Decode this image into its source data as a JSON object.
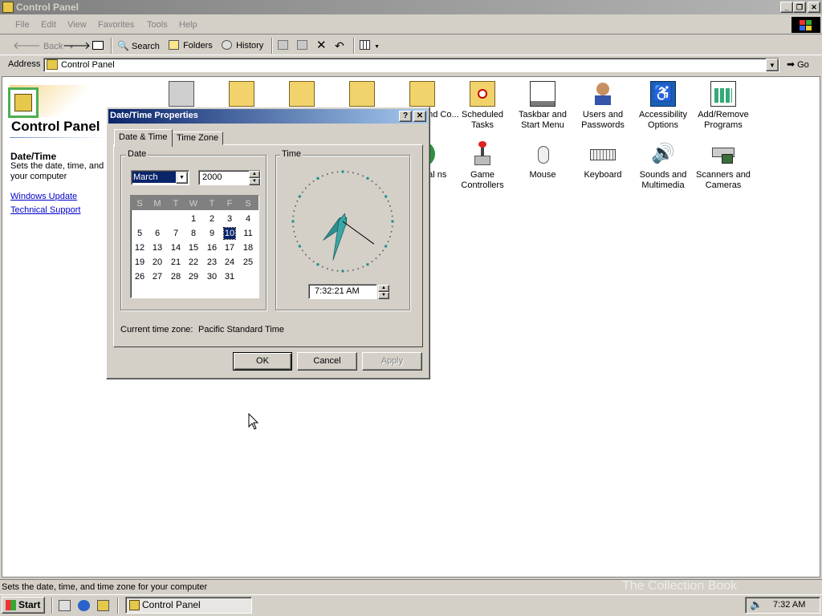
{
  "window": {
    "title": "Control Panel"
  },
  "menu": [
    "File",
    "Edit",
    "View",
    "Favorites",
    "Tools",
    "Help"
  ],
  "toolbar": {
    "back": "Back",
    "search": "Search",
    "folders": "Folders",
    "history": "History"
  },
  "address": {
    "label": "Address",
    "value": "Control Panel",
    "go": "Go"
  },
  "left_panel": {
    "heading": "Control Panel",
    "item_title": "Date/Time",
    "item_desc": "Sets the date, time, and your computer",
    "links": [
      "Windows Update",
      "Technical Support"
    ]
  },
  "icons_row1": [
    {
      "label": "and Co..."
    },
    {
      "label": "Scheduled Tasks"
    },
    {
      "label": "Taskbar and Start Menu"
    },
    {
      "label": "Users and Passwords"
    },
    {
      "label": "Accessibility Options"
    },
    {
      "label": "Add/Remove Programs"
    }
  ],
  "icons_row2": [
    {
      "label": "nal ns"
    },
    {
      "label": "Game Controllers"
    },
    {
      "label": "Mouse"
    },
    {
      "label": "Keyboard"
    },
    {
      "label": "Sounds and Multimedia"
    },
    {
      "label": "Scanners and Cameras"
    }
  ],
  "dialog": {
    "title": "Date/Time Properties",
    "tabs": [
      "Date & Time",
      "Time Zone"
    ],
    "date_group": "Date",
    "time_group": "Time",
    "month": "March",
    "year": "2000",
    "weekdays": [
      "S",
      "M",
      "T",
      "W",
      "T",
      "F",
      "S"
    ],
    "weeks": [
      [
        "",
        "",
        "",
        "1",
        "2",
        "3",
        "4"
      ],
      [
        "5",
        "6",
        "7",
        "8",
        "9",
        "10",
        "11"
      ],
      [
        "12",
        "13",
        "14",
        "15",
        "16",
        "17",
        "18"
      ],
      [
        "19",
        "20",
        "21",
        "22",
        "23",
        "24",
        "25"
      ],
      [
        "26",
        "27",
        "28",
        "29",
        "30",
        "31",
        ""
      ]
    ],
    "selected_day": "10",
    "time": "7:32:21 AM",
    "clock": {
      "hour": 7,
      "minute": 32,
      "second": 21
    },
    "timezone_label": "Current time zone:",
    "timezone_value": "Pacific Standard Time",
    "buttons": {
      "ok": "OK",
      "cancel": "Cancel",
      "apply": "Apply"
    }
  },
  "statusbar": {
    "text": "Sets the date, time, and time zone for your computer"
  },
  "taskbar": {
    "start": "Start",
    "item": "Control Panel",
    "clock": "7:32 AM"
  },
  "watermark": "The Collection Book"
}
